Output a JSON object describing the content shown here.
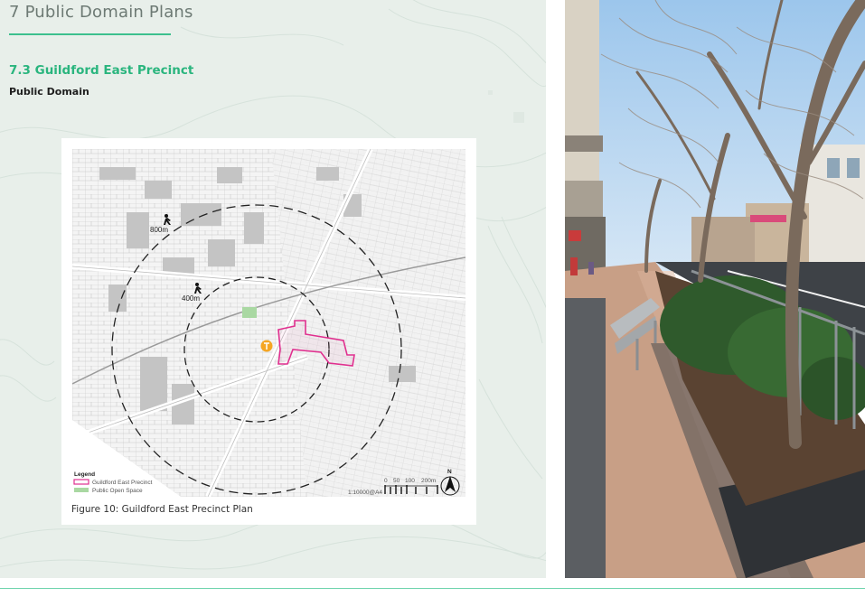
{
  "page": {
    "chapter_title": "7 Public Domain Plans",
    "section_title": "7.3 Guildford East Precinct",
    "subsection_title": "Public Domain"
  },
  "figure": {
    "caption": "Figure 10: Guildford East Precinct Plan",
    "ring_labels": {
      "outer": "800m",
      "inner": "400m"
    },
    "legend": {
      "title": "Legend",
      "items": [
        {
          "label": "Guildford East Precinct",
          "color": "#e0308f"
        },
        {
          "label": "Public Open Space",
          "color": "#a9d8a2"
        }
      ]
    },
    "scale_text": "1:10000@A4",
    "scale_ticks": [
      "0",
      "50",
      "100",
      "200m"
    ],
    "north_label": "N",
    "station_icon": "train-station-icon",
    "walk_icon": "pedestrian-icon"
  },
  "photo": {
    "subject": "street-scene-photo"
  },
  "colors": {
    "accent": "#2ab57e",
    "panel_bg": "#e8efea",
    "precinct": "#e0308f",
    "station": "#f5a623"
  }
}
